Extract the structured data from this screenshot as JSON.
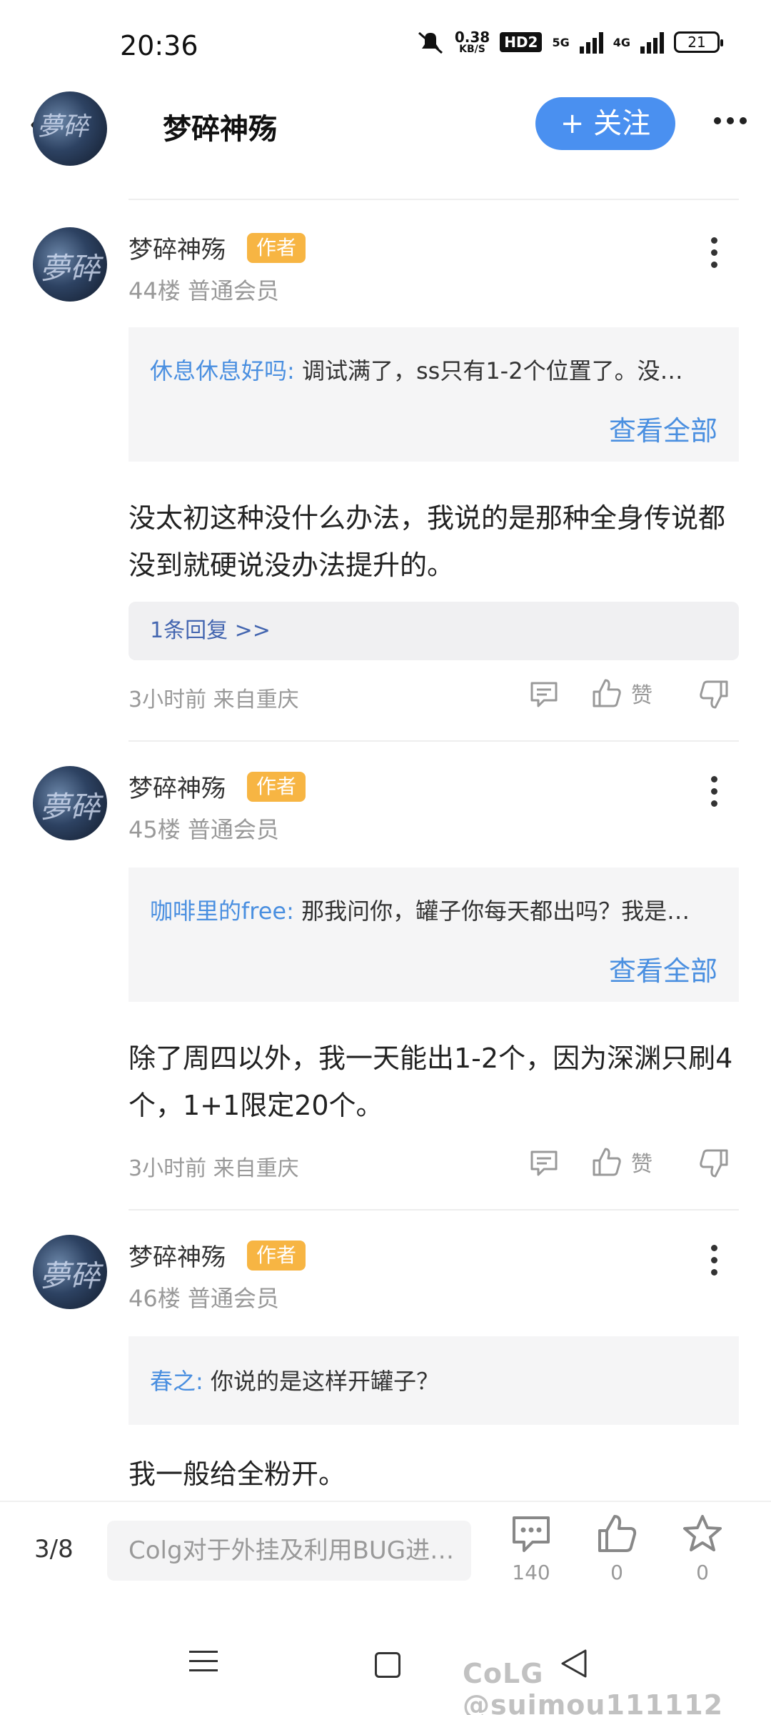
{
  "status_bar": {
    "time": "20:36",
    "net_speed": "0.38",
    "net_unit": "KB/S",
    "hd": "HD2",
    "net1": "5G",
    "net2": "4G",
    "battery": "21"
  },
  "header": {
    "title": "梦碎神殇",
    "follow_label": "+ 关注",
    "avatar_text": "夢碎"
  },
  "posts": [
    {
      "username": "梦碎神殇",
      "badge": "作者",
      "meta": "44楼 普通会员",
      "quote_name": "休息休息好吗:",
      "quote_text": " 调试满了，ss只有1-2个位置了。没…",
      "quote_more": "查看全部",
      "content": "没太初这种没什么办法，我说的是那种全身传说都没到就硬说没办法提升的。",
      "replies": "1条回复 >>",
      "time_location": "3小时前 来自重庆",
      "like_label": "赞"
    },
    {
      "username": "梦碎神殇",
      "badge": "作者",
      "meta": "45楼 普通会员",
      "quote_name": "咖啡里的free:",
      "quote_text": " 那我问你，罐子你每天都出吗？我是…",
      "quote_more": "查看全部",
      "content": "除了周四以外，我一天能出1-2个，因为深渊只刷4个，1+1限定20个。",
      "time_location": "3小时前 来自重庆",
      "like_label": "赞"
    },
    {
      "username": "梦碎神殇",
      "badge": "作者",
      "meta": "46楼 普通会员",
      "quote_name": "春之:",
      "quote_text": " 你说的是这样开罐子？",
      "content": "我一般给全粉开。"
    }
  ],
  "bottom_bar": {
    "page": "3/8",
    "input_placeholder": "Colg对于外挂及利用BUG进…",
    "comment_count": "140",
    "like_count": "0",
    "favorite_count": "0"
  },
  "watermark": "CoLG @suimou111112",
  "colors": {
    "accent": "#4a90f0",
    "link": "#4a8fe0",
    "badge": "#f7b543"
  },
  "icons": [
    "back-icon",
    "more-icon",
    "comment-icon",
    "thumbs-up-icon",
    "thumbs-down-icon",
    "star-icon",
    "menu-icon",
    "home-icon",
    "nav-back-icon"
  ]
}
